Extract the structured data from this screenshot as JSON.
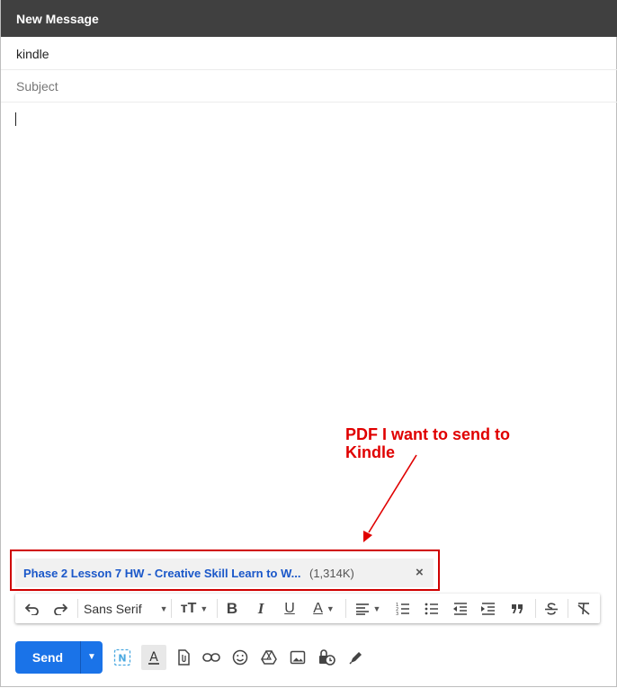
{
  "window": {
    "title": "New Message"
  },
  "to": {
    "value": "kindle"
  },
  "subject": {
    "placeholder": "Subject"
  },
  "annotation": {
    "text": "PDF I want to send to Kindle",
    "color": "#e00000"
  },
  "attachment": {
    "name": "Phase 2 Lesson 7 HW - Creative Skill Learn to W...",
    "size": "(1,314K)",
    "close": "×"
  },
  "format_toolbar": {
    "font": "Sans Serif",
    "items": [
      "undo-icon",
      "redo-icon",
      "font-select",
      "text-size-icon",
      "bold-icon",
      "italic-icon",
      "underline-icon",
      "text-color-icon",
      "align-icon",
      "numbered-list-icon",
      "bulleted-list-icon",
      "indent-less-icon",
      "indent-more-icon",
      "quote-icon",
      "strikethrough-icon",
      "remove-formatting-icon"
    ],
    "bold": "B",
    "italic": "I",
    "underline": "U",
    "text_color": "A",
    "text_size": "тT"
  },
  "actions": {
    "send_label": "Send",
    "items": [
      "grammarly-icon",
      "formatting-options-icon",
      "attach-file-icon",
      "insert-link-icon",
      "insert-emoji-icon",
      "google-drive-icon",
      "insert-photo-icon",
      "confidential-mode-icon",
      "insert-signature-icon"
    ]
  },
  "colors": {
    "titlebar": "#404040",
    "send": "#1a73e8",
    "link": "#1a57c9"
  }
}
